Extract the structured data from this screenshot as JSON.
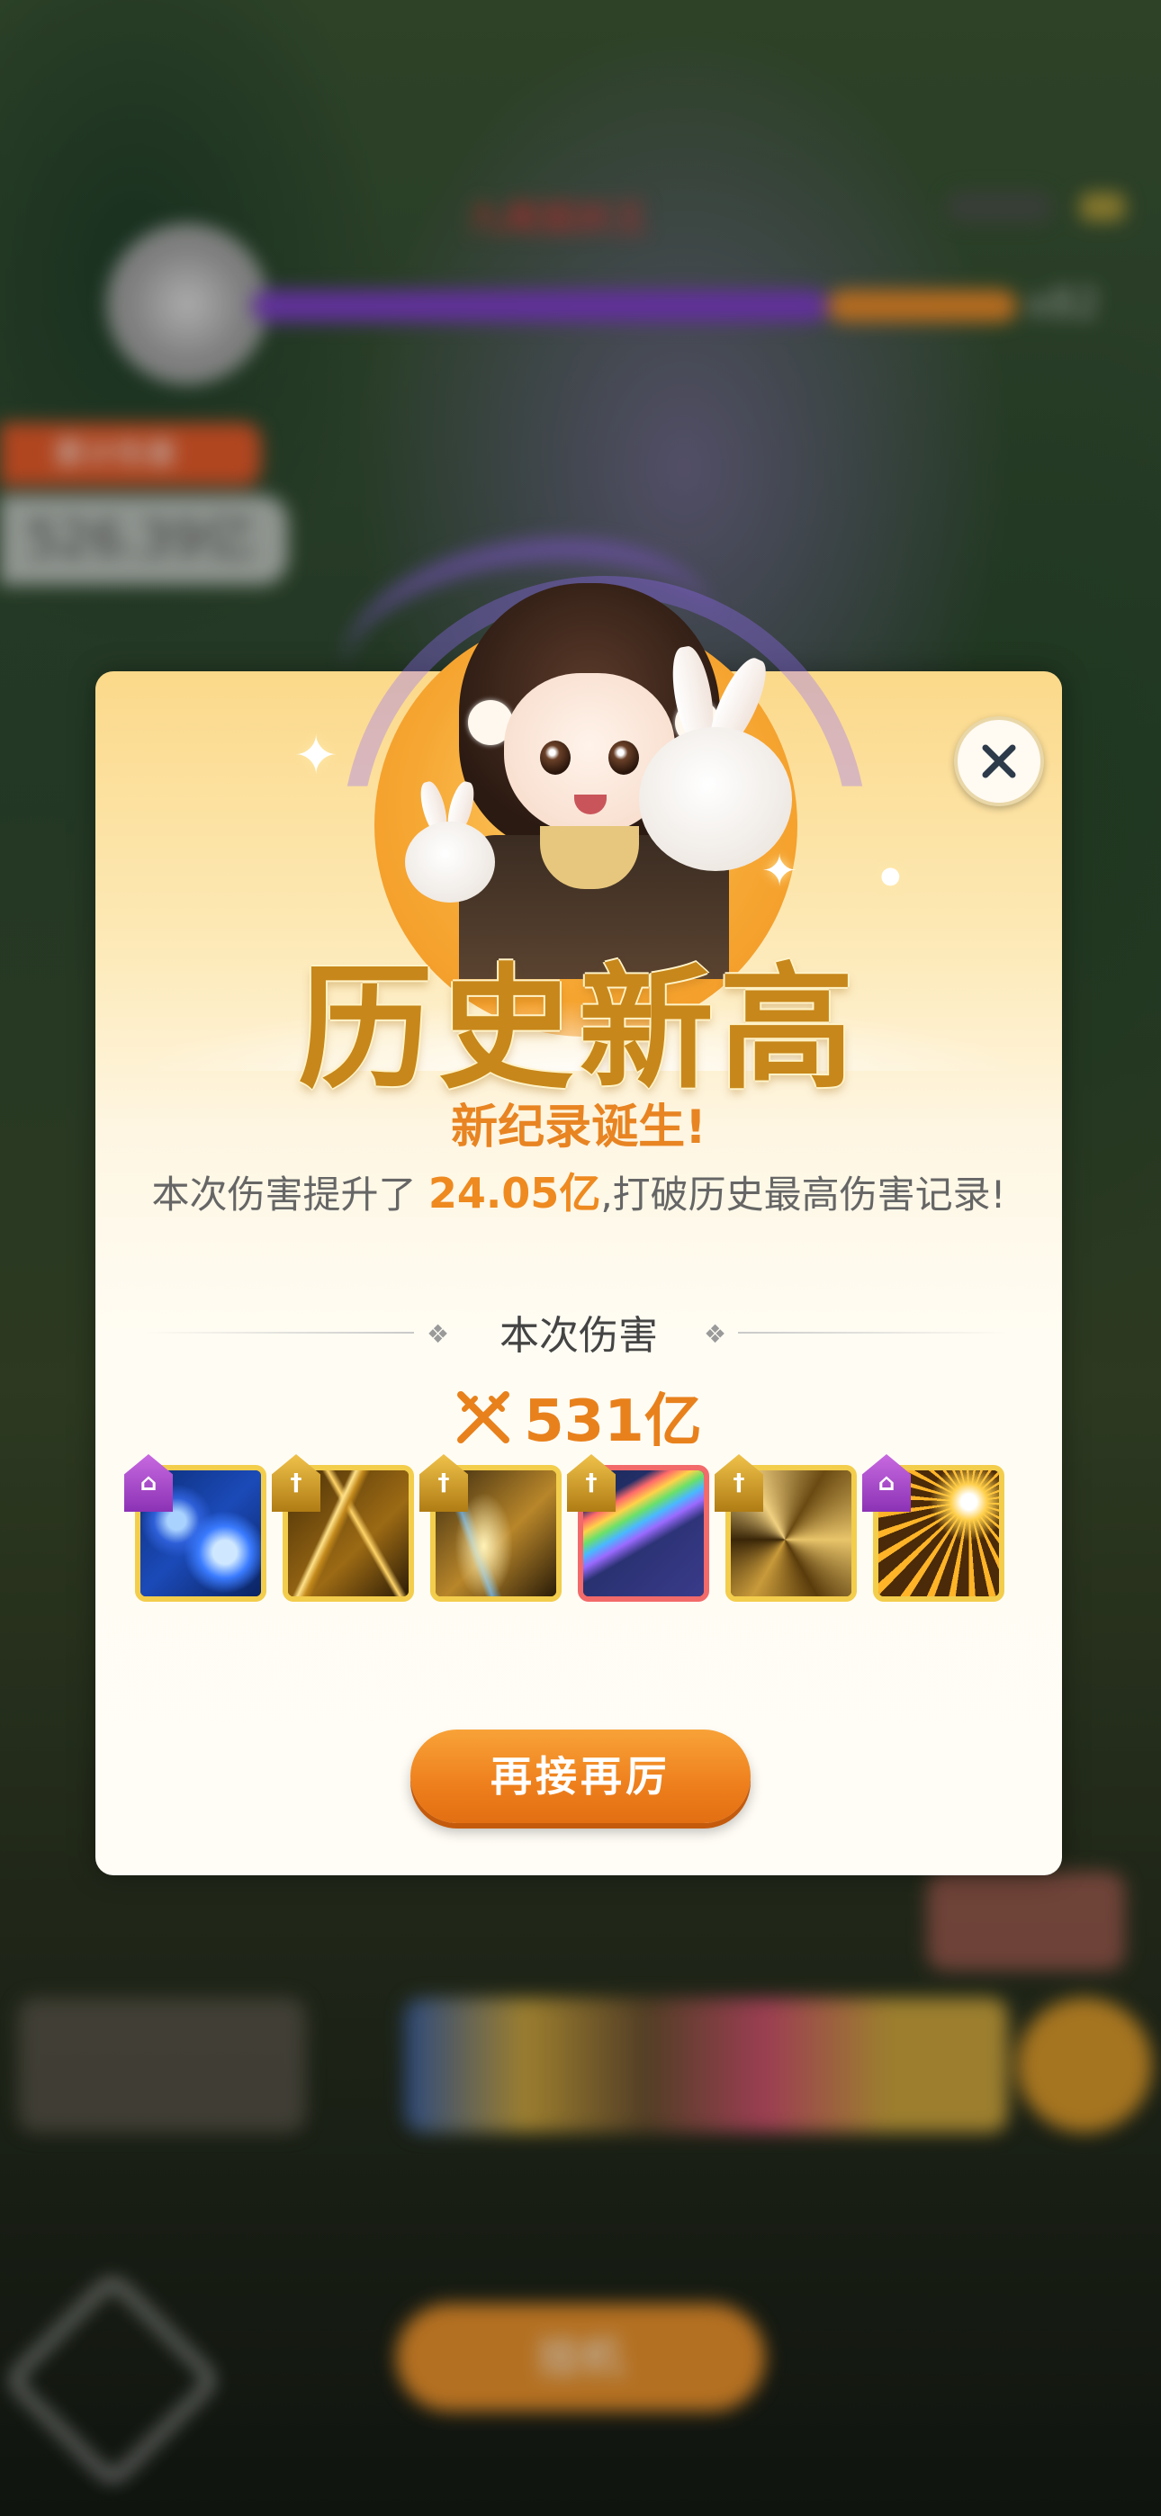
{
  "background": {
    "boss_name": "九尾狐妖王",
    "hp_multiplier": "x82",
    "damage_badge": "累计伤害",
    "damage_total": "526.39亿",
    "bottom_button": "挂机"
  },
  "modal": {
    "title": "历史新高",
    "subtitle": "新纪录诞生!",
    "desc_prefix": "本次伤害提升了 ",
    "desc_value": "24.05亿",
    "desc_suffix": ",打破历史最高伤害记录!",
    "section_title": "本次伤害",
    "damage_value": "531亿",
    "retry_label": "再接再厉"
  },
  "skills": [
    {
      "name": "blue-lightning-orb",
      "tag": "purple",
      "tag_icon": "pagoda",
      "border": "gold"
    },
    {
      "name": "golden-blades",
      "tag": "gold",
      "tag_icon": "sword",
      "border": "gold"
    },
    {
      "name": "golden-claw-slash",
      "tag": "gold",
      "tag_icon": "sword",
      "border": "gold"
    },
    {
      "name": "rainbow-meteor",
      "tag": "gold",
      "tag_icon": "sword",
      "border": "red"
    },
    {
      "name": "golden-shards",
      "tag": "gold",
      "tag_icon": "sword",
      "border": "gold"
    },
    {
      "name": "radiant-burst",
      "tag": "purple",
      "tag_icon": "pagoda",
      "border": "gold"
    }
  ],
  "colors": {
    "accent_orange": "#ee8a20",
    "title_gold": "#c7871a",
    "tag_purple": "#8b32b5",
    "tag_gold": "#b07c14"
  }
}
